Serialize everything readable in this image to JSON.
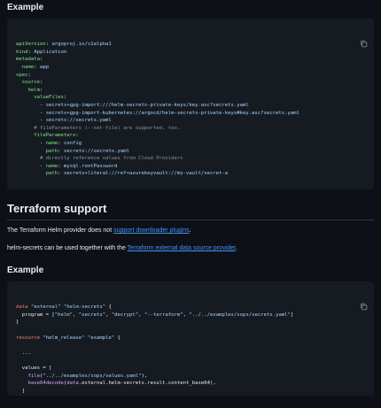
{
  "section1": {
    "heading": "Example",
    "code_lines": [
      [
        [
          "k",
          "apiVersion"
        ],
        [
          "p",
          ": "
        ],
        [
          "s",
          "argoproj.io/v1alpha1"
        ]
      ],
      [
        [
          "k",
          "kind"
        ],
        [
          "p",
          ": "
        ],
        [
          "s",
          "Application"
        ]
      ],
      [
        [
          "k",
          "metadata"
        ],
        [
          "p",
          ":"
        ]
      ],
      [
        [
          "p",
          "  "
        ],
        [
          "k",
          "name"
        ],
        [
          "p",
          ": "
        ],
        [
          "s",
          "app"
        ]
      ],
      [
        [
          "k",
          "spec"
        ],
        [
          "p",
          ":"
        ]
      ],
      [
        [
          "p",
          "  "
        ],
        [
          "k",
          "source"
        ],
        [
          "p",
          ":"
        ]
      ],
      [
        [
          "p",
          "    "
        ],
        [
          "k",
          "helm"
        ],
        [
          "p",
          ":"
        ]
      ],
      [
        [
          "p",
          "      "
        ],
        [
          "k",
          "valueFiles"
        ],
        [
          "p",
          ":"
        ]
      ],
      [
        [
          "p",
          "        - "
        ],
        [
          "s",
          "secrets+gpg-import:///helm-secrets-private-keys/key.asc?secrets.yaml"
        ]
      ],
      [
        [
          "p",
          "        - "
        ],
        [
          "s",
          "secrets+gpg-import-kubernetes://argocd/helm-secrets-private-keys#key.asc?secrets.yaml"
        ]
      ],
      [
        [
          "p",
          "        - "
        ],
        [
          "s",
          "secrets://secrets.yaml"
        ]
      ],
      [
        [
          "p",
          "      "
        ],
        [
          "c",
          "# fileParameters (--set-file) are supported, too."
        ]
      ],
      [
        [
          "p",
          "      "
        ],
        [
          "k",
          "fileParameters"
        ],
        [
          "p",
          ":"
        ]
      ],
      [
        [
          "p",
          "        - "
        ],
        [
          "k",
          "name"
        ],
        [
          "p",
          ": "
        ],
        [
          "s",
          "config"
        ]
      ],
      [
        [
          "p",
          "          "
        ],
        [
          "k",
          "path"
        ],
        [
          "p",
          ": "
        ],
        [
          "s",
          "secrets://secrets.yaml"
        ]
      ],
      [
        [
          "p",
          "        "
        ],
        [
          "c",
          "# directly reference values from Cloud Providers"
        ]
      ],
      [
        [
          "p",
          "        - "
        ],
        [
          "k",
          "name"
        ],
        [
          "p",
          ": "
        ],
        [
          "s",
          "mysql.rootPassword"
        ]
      ],
      [
        [
          "p",
          "          "
        ],
        [
          "k",
          "path"
        ],
        [
          "p",
          ": "
        ],
        [
          "s",
          "secrets+literal://ref+azurekeyvault://my-vault/secret-a"
        ]
      ]
    ]
  },
  "terraform": {
    "heading": "Terraform support",
    "para1_prefix": "The Terraform Helm provider does not ",
    "para1_link": "support downloader plugins",
    "para1_suffix": ".",
    "para2_prefix": "helm-secrets can be used together with the ",
    "para2_link": "Terraform external data source provider",
    "para2_suffix": "."
  },
  "section2": {
    "heading": "Example",
    "code_lines": [
      [
        [
          "r",
          "data"
        ],
        [
          "p",
          " "
        ],
        [
          "s",
          "\"external\""
        ],
        [
          "p",
          " "
        ],
        [
          "s",
          "\"helm-secrets\""
        ],
        [
          "p",
          " {"
        ]
      ],
      [
        [
          "p",
          "  program = ["
        ],
        [
          "s",
          "\"helm\""
        ],
        [
          "p",
          ", "
        ],
        [
          "s",
          "\"secrets\""
        ],
        [
          "p",
          ", "
        ],
        [
          "s",
          "\"decrypt\""
        ],
        [
          "p",
          ", "
        ],
        [
          "s",
          "\"--terraform\""
        ],
        [
          "p",
          ", "
        ],
        [
          "s",
          "\"../../examples/sops/secrets.yaml\""
        ],
        [
          "p",
          "]"
        ]
      ],
      [
        [
          "p",
          "}"
        ]
      ],
      [
        [
          "p",
          ""
        ]
      ],
      [
        [
          "r",
          "resource"
        ],
        [
          "p",
          " "
        ],
        [
          "s",
          "\"helm_release\""
        ],
        [
          "p",
          " "
        ],
        [
          "s",
          "\"example\""
        ],
        [
          "p",
          " {"
        ]
      ],
      [
        [
          "p",
          ""
        ]
      ],
      [
        [
          "p",
          "  ..."
        ]
      ],
      [
        [
          "p",
          ""
        ]
      ],
      [
        [
          "p",
          "  values = ["
        ]
      ],
      [
        [
          "p",
          "    "
        ],
        [
          "f",
          "file"
        ],
        [
          "p",
          "("
        ],
        [
          "s",
          "\"../../examples/sops/values.yaml\""
        ],
        [
          "p",
          "),"
        ]
      ],
      [
        [
          "p",
          "    "
        ],
        [
          "f",
          "base64decode"
        ],
        [
          "p",
          "("
        ],
        [
          "f",
          "data"
        ],
        [
          "p",
          ".external.helm-secrets.result.content_base64),"
        ]
      ],
      [
        [
          "p",
          "  ]"
        ]
      ],
      [
        [
          "p",
          "}"
        ]
      ]
    ]
  },
  "icons": {
    "copy": "copy-icon"
  }
}
